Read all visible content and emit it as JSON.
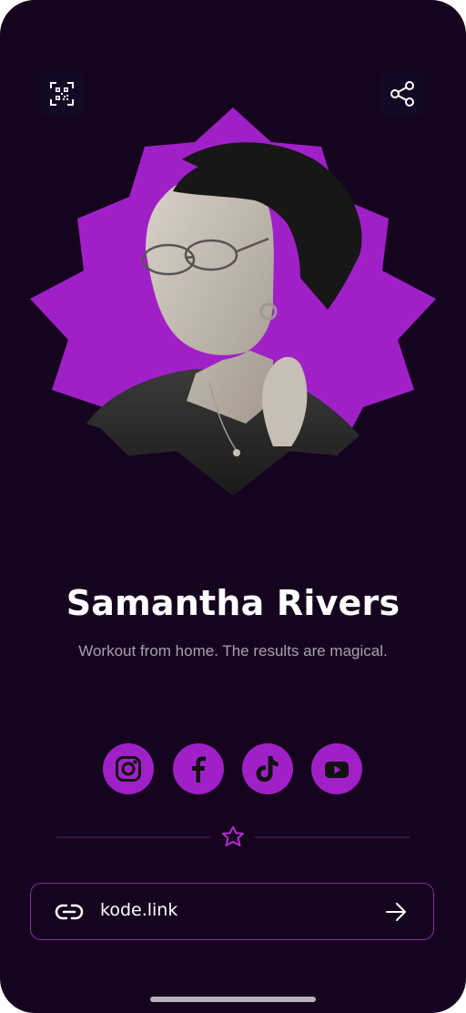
{
  "profile": {
    "name": "Samantha Rivers",
    "tagline": "Workout from home. The results are magical."
  },
  "actions": {
    "qr_icon": "qr-code-icon",
    "share_icon": "share-icon"
  },
  "socials": [
    {
      "id": "instagram",
      "icon": "instagram-icon"
    },
    {
      "id": "facebook",
      "icon": "facebook-icon"
    },
    {
      "id": "tiktok",
      "icon": "tiktok-icon"
    },
    {
      "id": "youtube",
      "icon": "youtube-icon"
    }
  ],
  "link": {
    "text": "kode.link",
    "icon": "link-icon",
    "action_icon": "arrow-right-icon"
  },
  "colors": {
    "background": "#16041f",
    "accent": "#a020c8",
    "text_primary": "#ffffff",
    "text_secondary": "#a89fb0"
  }
}
